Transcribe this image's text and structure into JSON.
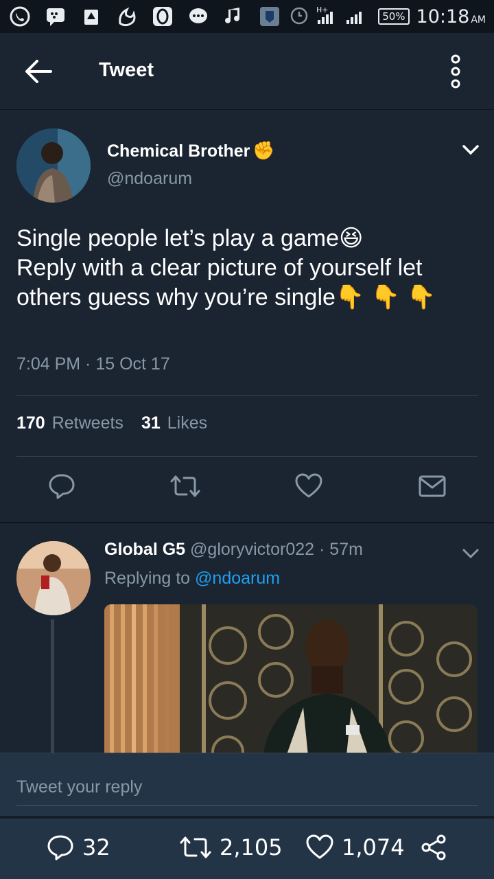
{
  "status_bar": {
    "battery": "50%",
    "time": "10:18",
    "ampm": "AM",
    "network": "H+",
    "icons": [
      "whatsapp-icon",
      "bbm-icon",
      "drive-icon",
      "uc-browser-icon",
      "opera-icon",
      "messaging-icon",
      "music-icon",
      "security-icon",
      "alarm-icon",
      "signal-icon"
    ]
  },
  "header": {
    "title": "Tweet"
  },
  "tweet": {
    "author_name": "Chemical Brother",
    "author_emoji": "✊",
    "author_handle": "@ndoarum",
    "text": "Single people let’s play a game😆\nReply with a clear picture of yourself let others guess why you’re single👇 👇 👇",
    "timestamp": "7:04 PM · 15 Oct 17",
    "retweets_count": "170",
    "retweets_label": "Retweets",
    "likes_count": "31",
    "likes_label": "Likes"
  },
  "reply": {
    "author_name": "Global G5",
    "author_handle": "@gloryvictor022",
    "time_ago": "57m",
    "replying_prefix": "Replying to",
    "replying_handle": "@ndoarum"
  },
  "composer": {
    "placeholder": "Tweet your reply"
  },
  "bottom_bar": {
    "replies": "32",
    "retweets": "2,105",
    "likes": "1,074"
  },
  "colors": {
    "background": "#1b2431",
    "accent": "#1da1f2",
    "muted": "#8899a6",
    "icon": "#8899a6"
  }
}
